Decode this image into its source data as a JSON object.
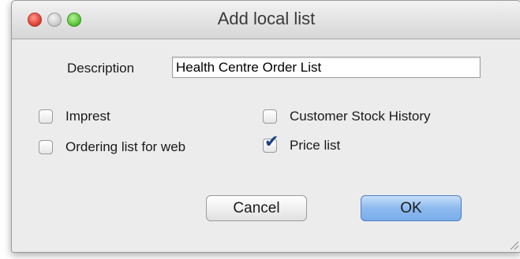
{
  "window": {
    "title": "Add local list"
  },
  "form": {
    "description_label": "Description",
    "description_value": "Health Centre Order List"
  },
  "options": {
    "impress": {
      "label": "Imprest",
      "checked": false
    },
    "ordering_list_for_web": {
      "label": "Ordering list for web",
      "checked": false
    },
    "customer_stock_history": {
      "label": "Customer Stock History",
      "checked": false
    },
    "price_list": {
      "label": "Price list",
      "checked": true
    }
  },
  "buttons": {
    "cancel": "Cancel",
    "ok": "OK"
  },
  "icons": {
    "close": "close-icon",
    "minimize": "minimize-icon",
    "zoom": "zoom-icon",
    "checkmark": "checkmark-icon",
    "resize": "resize-grip-icon"
  },
  "colors": {
    "accent": "#8db9ef",
    "check": "#1b3f86"
  }
}
